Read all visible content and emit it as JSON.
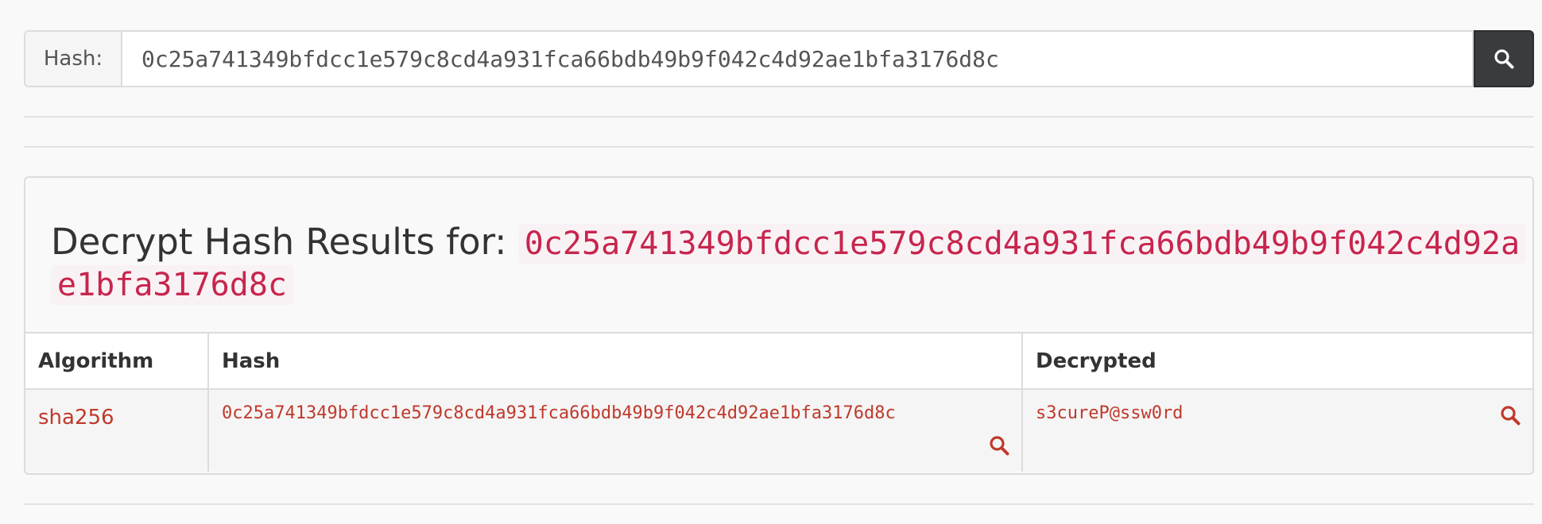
{
  "search": {
    "label": "Hash:",
    "value": "0c25a741349bfdcc1e579c8cd4a931fca66bdb49b9f042c4d92ae1bfa3176d8c",
    "button_icon": "search-icon"
  },
  "results": {
    "heading_prefix": "Decrypt Hash Results for:",
    "heading_hash": "0c25a741349bfdcc1e579c8cd4a931fca66bdb49b9f042c4d92ae1bfa3176d8c",
    "columns": [
      "Algorithm",
      "Hash",
      "Decrypted"
    ],
    "rows": [
      {
        "algorithm": "sha256",
        "hash": "0c25a741349bfdcc1e579c8cd4a931fca66bdb49b9f042c4d92ae1bfa3176d8c",
        "decrypted": "s3cureP@ssw0rd"
      }
    ]
  },
  "colors": {
    "accent_red": "#c0392b",
    "code_red": "#c7254e",
    "search_button": "#3a3b3c"
  }
}
